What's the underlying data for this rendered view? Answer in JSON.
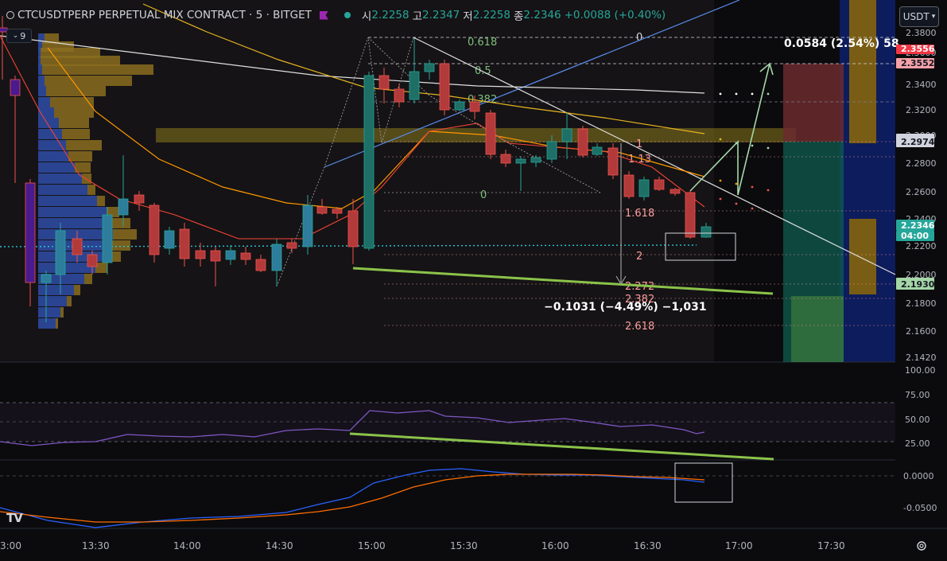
{
  "header": {
    "symbol_title": "CTCUSDTPERP PERPETUAL MIX CONTRACT · 5 · BITGET",
    "open_label": "시",
    "open_value": "2.2258",
    "high_label": "고",
    "high_value": "2.2347",
    "low_label": "저",
    "low_value": "2.2258",
    "close_label": "종",
    "close_value": "2.2346",
    "change": "+0.0088 (+0.40%)"
  },
  "currency_button": "USDT",
  "indicator_count": "9",
  "price_axis": {
    "ticks": [
      "2.3800",
      "2.3600",
      "2.3400",
      "2.3200",
      "2.3000",
      "2.2800",
      "2.2600",
      "2.2400",
      "2.2200",
      "2.2000",
      "2.1800",
      "2.1600",
      "2.1420"
    ],
    "labels": [
      {
        "text": "2.3556",
        "bg": "#f23645",
        "fg": "#ffffff"
      },
      {
        "text": "2.3552",
        "bg": "#f7a1a8",
        "fg": "#131722"
      },
      {
        "text": "2.2974",
        "bg": "#d1d4dc",
        "fg": "#131722"
      },
      {
        "text": "2.2346",
        "bg": "#26a69a",
        "fg": "#ffffff"
      },
      {
        "text": "04:00",
        "bg": "#26a69a",
        "fg": "#ffffff"
      },
      {
        "text": "2.1930",
        "bg": "#a5d6a7",
        "fg": "#131722"
      }
    ]
  },
  "rsi_axis": [
    "100.00",
    "75.00",
    "50.00",
    "25.00"
  ],
  "macd_axis": [
    "0.0000",
    "-0.0500"
  ],
  "time_axis": [
    "3:00",
    "13:30",
    "14:00",
    "14:30",
    "15:00",
    "15:30",
    "16:00",
    "16:30",
    "17:00",
    "17:30"
  ],
  "fib_top": [
    "0.618",
    "0.5",
    "0.382",
    "0",
    "0"
  ],
  "fib_right": [
    "1",
    "1.13",
    "1.618",
    "2",
    "2.272",
    "2.382",
    "2.618"
  ],
  "measure_up": "0.0584 (2.54%) 58",
  "measure_down": "−0.1031 (−4.49%) −1,031",
  "colors": {
    "up": "#26a69a",
    "down": "#ef5350",
    "bg": "#0b0b0d",
    "volume_profile_blue": "#2e4a9e",
    "volume_profile_gold": "#8a6d1e",
    "fib_text": "#7fbf7f",
    "fib_ext_text": "#ff9e9e",
    "trend_green": "#8bc34a",
    "rsi": "#7e57c2",
    "macd": "#2962ff",
    "signal": "#ff6d00"
  }
}
